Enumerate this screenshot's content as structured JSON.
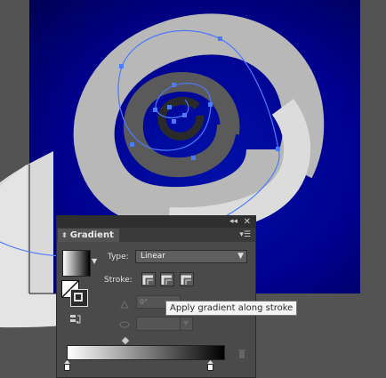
{
  "panel": {
    "tab_label": "Gradient",
    "type_label": "Type:",
    "type_value": "Linear",
    "stroke_label": "Stroke:",
    "angle_value": "0°"
  },
  "tooltip": {
    "text": "Apply gradient along stroke"
  },
  "icons": {
    "collapse": "collapse-double-arrow-icon",
    "close": "close-icon",
    "panel_menu": "panel-menu-icon",
    "trash": "trash-icon",
    "reverse": "reverse-gradient-icon"
  },
  "colors": {
    "canvas_bg": "#535353",
    "artboard_blue": "#00008a",
    "path_selection": "#4a7bff",
    "panel_bg": "#4a4a4a"
  }
}
